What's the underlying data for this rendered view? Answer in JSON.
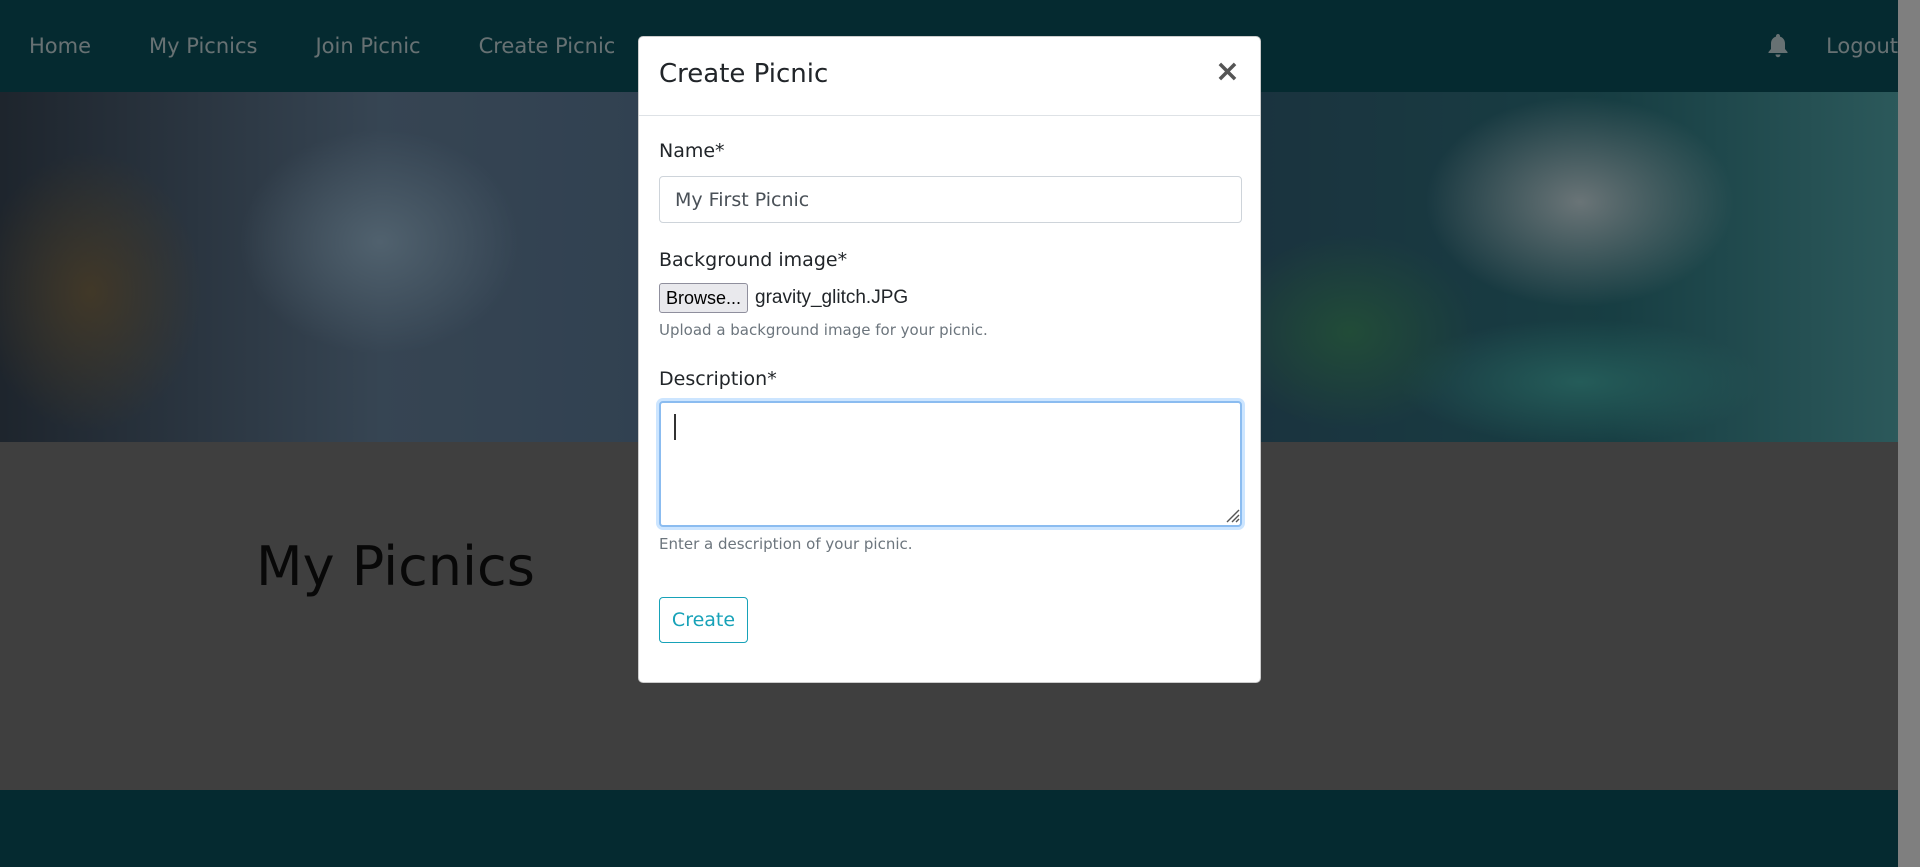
{
  "navbar": {
    "items": [
      {
        "label": "Home"
      },
      {
        "label": "My Picnics"
      },
      {
        "label": "Join Picnic"
      },
      {
        "label": "Create Picnic"
      }
    ],
    "logout_label": "Logout",
    "bell_icon": "bell-icon"
  },
  "page": {
    "heading": "My Picnics"
  },
  "modal": {
    "title": "Create Picnic",
    "close_symbol": "×",
    "name": {
      "label": "Name*",
      "value": "My First Picnic"
    },
    "background": {
      "label": "Background image*",
      "browse_label": "Browse...",
      "file_name": "gravity_glitch.JPG",
      "help": "Upload a background image for your picnic."
    },
    "description": {
      "label": "Description*",
      "value": "",
      "help": "Enter a description of your picnic."
    },
    "create_label": "Create"
  },
  "colors": {
    "navbar_bg": "#0b5560",
    "accent": "#17a2b8",
    "focus_ring": "#8bbcf0"
  }
}
